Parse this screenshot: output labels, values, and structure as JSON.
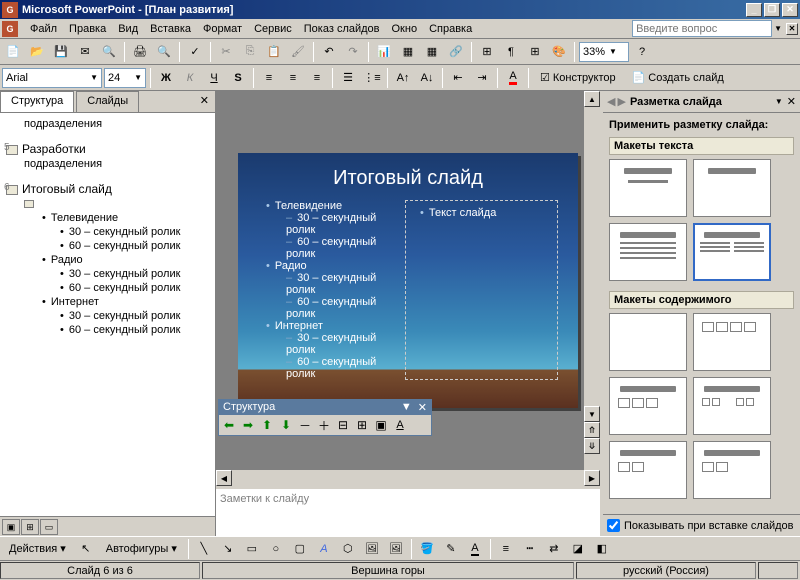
{
  "titlebar": {
    "app": "Microsoft PowerPoint",
    "doc": "[План развития]"
  },
  "menu": {
    "file": "Файл",
    "edit": "Правка",
    "view": "Вид",
    "insert": "Вставка",
    "format": "Формат",
    "tools": "Сервис",
    "slideshow": "Показ слайдов",
    "window": "Окно",
    "help": "Справка"
  },
  "helpbox": {
    "placeholder": "Введите вопрос"
  },
  "zoom": "33%",
  "font": {
    "name": "Arial",
    "size": "24"
  },
  "fmtbuttons": {
    "designer": "Конструктор",
    "newslide": "Создать слайд"
  },
  "tabs": {
    "structure": "Структура",
    "slides": "Слайды"
  },
  "outline": {
    "item0": "подразделения",
    "slide5": {
      "num": "5",
      "title": "Разработки",
      "sub": "подразделения"
    },
    "slide6": {
      "num": "6",
      "title": "Итоговый слайд",
      "b1": "Телевидение",
      "b1a": "30 – секундный ролик",
      "b1b": "60 – секундный ролик",
      "b2": "Радио",
      "b2a": "30 – секундный ролик",
      "b2b": "60 – секундный ролик",
      "b3": "Интернет",
      "b3a": "30 – секундный ролик",
      "b3b": "60 – секундный ролик"
    }
  },
  "outlinetb": {
    "title": "Структура"
  },
  "slide": {
    "title": "Итоговый слайд",
    "b1": "Телевидение",
    "s1a": "30 – секундный ролик",
    "s1b": "60 – секундный ролик",
    "b2": "Радио",
    "s2a": "30 – секундный ролик",
    "s2b": "60 – секундный ролик",
    "b3": "Интернет",
    "s3a": "30 – секундный ролик",
    "s3b": "60 – секундный ролик",
    "placeholder": "Текст слайда"
  },
  "notes": {
    "placeholder": "Заметки к слайду"
  },
  "taskpane": {
    "title": "Разметка слайда",
    "apply": "Применить разметку слайда:",
    "section1": "Макеты текста",
    "section2": "Макеты содержимого",
    "showcheck": "Показывать при вставке слайдов"
  },
  "drawbar": {
    "actions": "Действия",
    "autoshapes": "Автофигуры"
  },
  "status": {
    "slide": "Слайд 6 из 6",
    "design": "Вершина горы",
    "lang": "русский (Россия)"
  }
}
